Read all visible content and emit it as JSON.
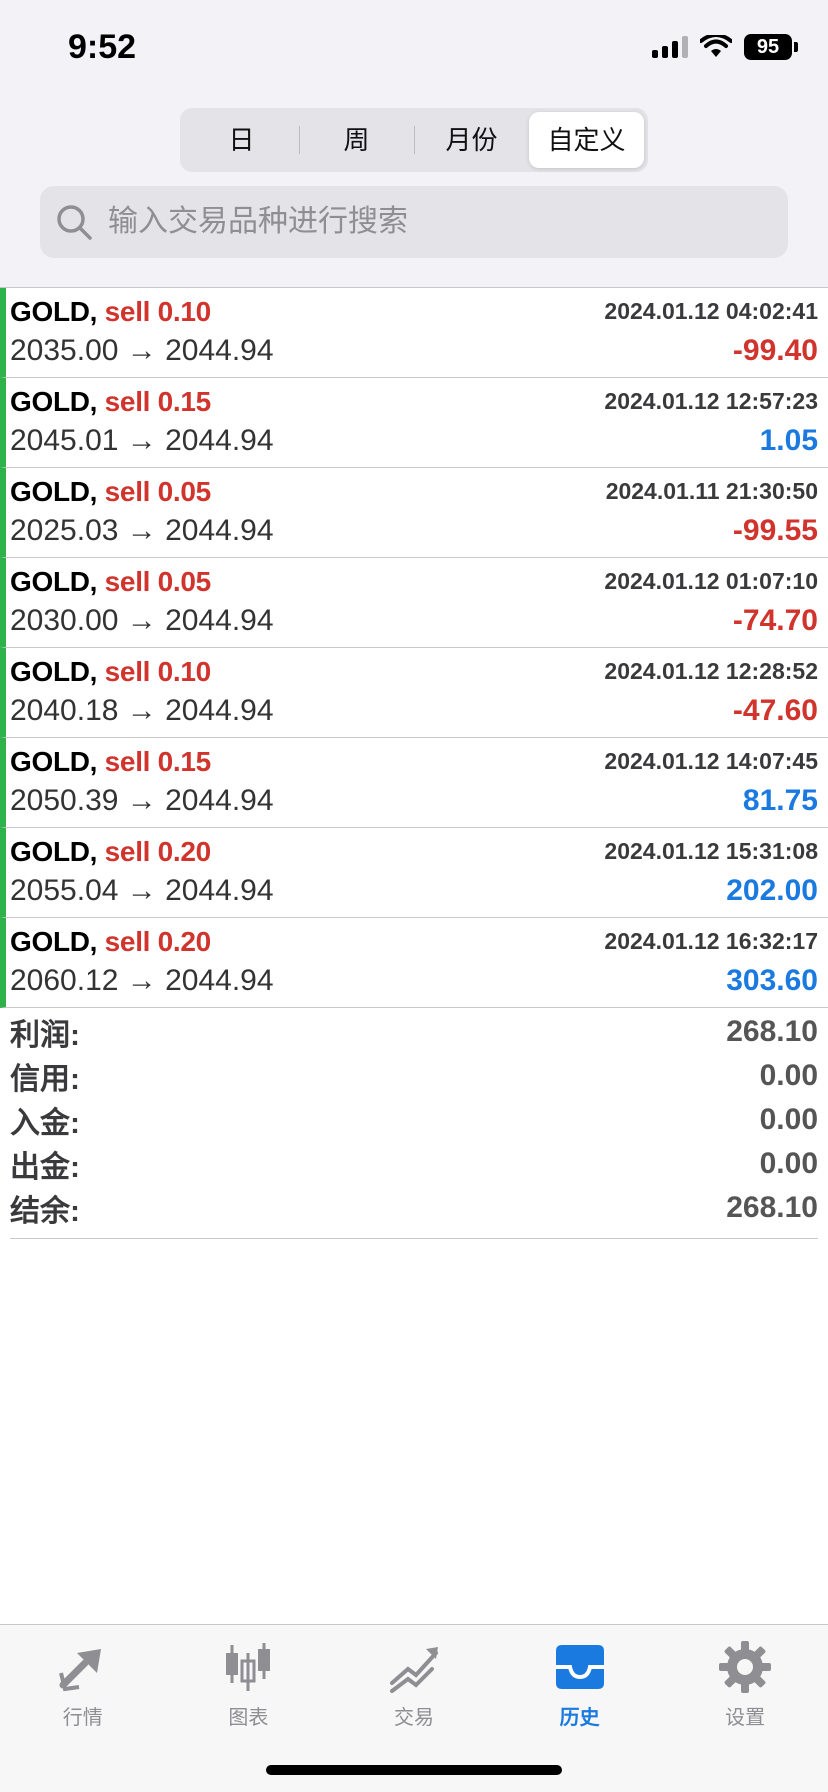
{
  "status": {
    "time": "9:52",
    "battery": "95"
  },
  "segments": [
    {
      "label": "日",
      "active": false
    },
    {
      "label": "周",
      "active": false
    },
    {
      "label": "月份",
      "active": false
    },
    {
      "label": "自定义",
      "active": true
    }
  ],
  "search": {
    "placeholder": "输入交易品种进行搜索"
  },
  "trades": [
    {
      "symbol": "GOLD,",
      "side": "sell 0.10",
      "time": "2024.01.12 04:02:41",
      "prices": "2035.00 → 2044.94",
      "profit": "-99.40",
      "positive": false
    },
    {
      "symbol": "GOLD,",
      "side": "sell 0.15",
      "time": "2024.01.12 12:57:23",
      "prices": "2045.01 → 2044.94",
      "profit": "1.05",
      "positive": true
    },
    {
      "symbol": "GOLD,",
      "side": "sell 0.05",
      "time": "2024.01.11 21:30:50",
      "prices": "2025.03 → 2044.94",
      "profit": "-99.55",
      "positive": false
    },
    {
      "symbol": "GOLD,",
      "side": "sell 0.05",
      "time": "2024.01.12 01:07:10",
      "prices": "2030.00 → 2044.94",
      "profit": "-74.70",
      "positive": false
    },
    {
      "symbol": "GOLD,",
      "side": "sell 0.10",
      "time": "2024.01.12 12:28:52",
      "prices": "2040.18 → 2044.94",
      "profit": "-47.60",
      "positive": false
    },
    {
      "symbol": "GOLD,",
      "side": "sell 0.15",
      "time": "2024.01.12 14:07:45",
      "prices": "2050.39 → 2044.94",
      "profit": "81.75",
      "positive": true
    },
    {
      "symbol": "GOLD,",
      "side": "sell 0.20",
      "time": "2024.01.12 15:31:08",
      "prices": "2055.04 → 2044.94",
      "profit": "202.00",
      "positive": true
    },
    {
      "symbol": "GOLD,",
      "side": "sell 0.20",
      "time": "2024.01.12 16:32:17",
      "prices": "2060.12 → 2044.94",
      "profit": "303.60",
      "positive": true
    }
  ],
  "summary": [
    {
      "label": "利润:",
      "value": "268.10"
    },
    {
      "label": "信用:",
      "value": "0.00"
    },
    {
      "label": "入金:",
      "value": "0.00"
    },
    {
      "label": "出金:",
      "value": "0.00"
    },
    {
      "label": "结余:",
      "value": "268.10"
    }
  ],
  "tabs": [
    {
      "label": "行情",
      "icon": "quotes-icon",
      "active": false
    },
    {
      "label": "图表",
      "icon": "chart-icon",
      "active": false
    },
    {
      "label": "交易",
      "icon": "trade-icon",
      "active": false
    },
    {
      "label": "历史",
      "icon": "history-icon",
      "active": true
    },
    {
      "label": "设置",
      "icon": "settings-icon",
      "active": false
    }
  ],
  "colors": {
    "negative": "#d0342c",
    "positive": "#1a7ae0",
    "accent": "#1a7ae0",
    "row_marker": "#2db34a"
  }
}
